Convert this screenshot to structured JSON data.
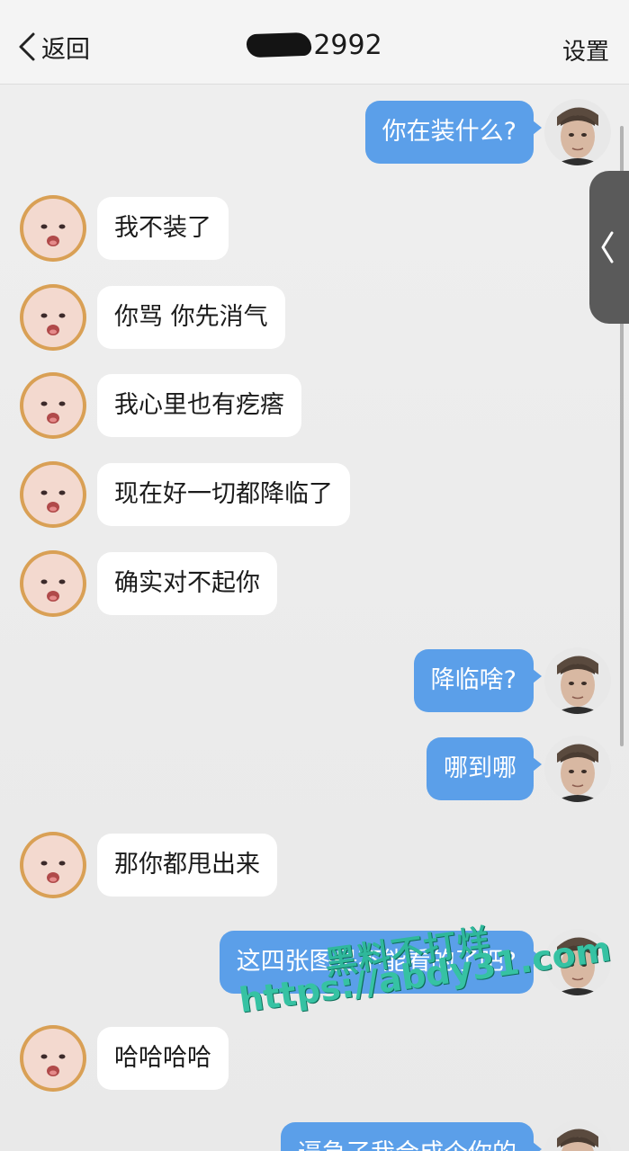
{
  "header": {
    "back_label": "返回",
    "title": "2992",
    "settings_label": "设置"
  },
  "messages": [
    {
      "side": "right",
      "text": "你在装什么?"
    },
    {
      "side": "left",
      "text": "我不装了"
    },
    {
      "side": "left",
      "text": "你骂 你先消气"
    },
    {
      "side": "left",
      "text": "我心里也有疙瘩"
    },
    {
      "side": "left",
      "text": "现在好一切都降临了"
    },
    {
      "side": "left",
      "text": "确实对不起你"
    },
    {
      "side": "right",
      "text": "降临啥?"
    },
    {
      "side": "right",
      "text": "哪到哪"
    },
    {
      "side": "left",
      "text": "那你都甩出来"
    },
    {
      "side": "right",
      "text": "这四张图是不能看的了吧?"
    },
    {
      "side": "left",
      "text": "哈哈哈哈"
    },
    {
      "side": "right",
      "text": "逼急了我合成个你的"
    }
  ],
  "watermark": {
    "line1": "黑料不打烊",
    "line2": "https://abdy31.com"
  },
  "colors": {
    "sent_bubble": "#5b9fe9",
    "received_bubble": "#ffffff",
    "background": "#ececec"
  }
}
